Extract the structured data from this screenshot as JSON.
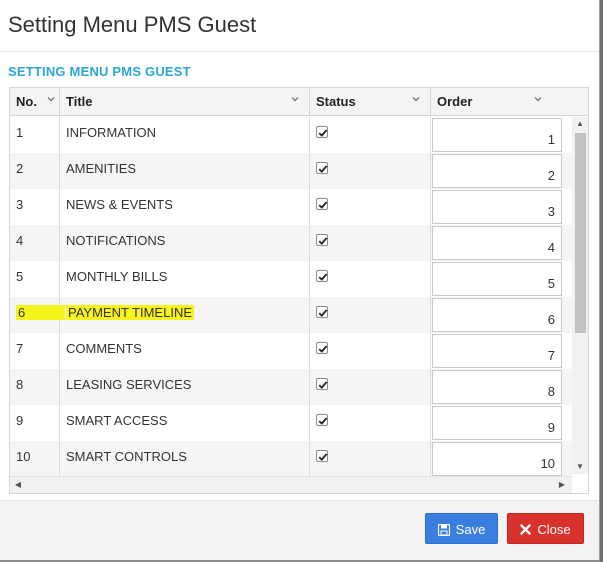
{
  "modal": {
    "title": "Setting Menu PMS Guest",
    "section_title": "SETTING MENU PMS GUEST"
  },
  "grid": {
    "columns": [
      {
        "label": "No."
      },
      {
        "label": "Title"
      },
      {
        "label": "Status"
      },
      {
        "label": "Order"
      }
    ],
    "rows": [
      {
        "no": "1",
        "title": "INFORMATION",
        "status": true,
        "order": "1"
      },
      {
        "no": "2",
        "title": "AMENITIES",
        "status": true,
        "order": "2"
      },
      {
        "no": "3",
        "title": "NEWS & EVENTS",
        "status": true,
        "order": "3"
      },
      {
        "no": "4",
        "title": "NOTIFICATIONS",
        "status": true,
        "order": "4"
      },
      {
        "no": "5",
        "title": "MONTHLY BILLS",
        "status": true,
        "order": "5"
      },
      {
        "no": "6",
        "title": "PAYMENT TIMELINE",
        "status": true,
        "order": "6",
        "highlighted": true
      },
      {
        "no": "7",
        "title": "COMMENTS",
        "status": true,
        "order": "7"
      },
      {
        "no": "8",
        "title": "LEASING SERVICES",
        "status": true,
        "order": "8"
      },
      {
        "no": "9",
        "title": "SMART ACCESS",
        "status": true,
        "order": "9"
      },
      {
        "no": "10",
        "title": "SMART CONTROLS",
        "status": true,
        "order": "10"
      }
    ]
  },
  "footer": {
    "save_label": "Save",
    "close_label": "Close",
    "save_icon": "floppy-disk-icon",
    "close_icon": "x-icon",
    "save_color": "#3a7fe0",
    "close_color": "#d9312b"
  },
  "colors": {
    "accent": "#2aa7d9",
    "highlight": "#f6f31a"
  }
}
